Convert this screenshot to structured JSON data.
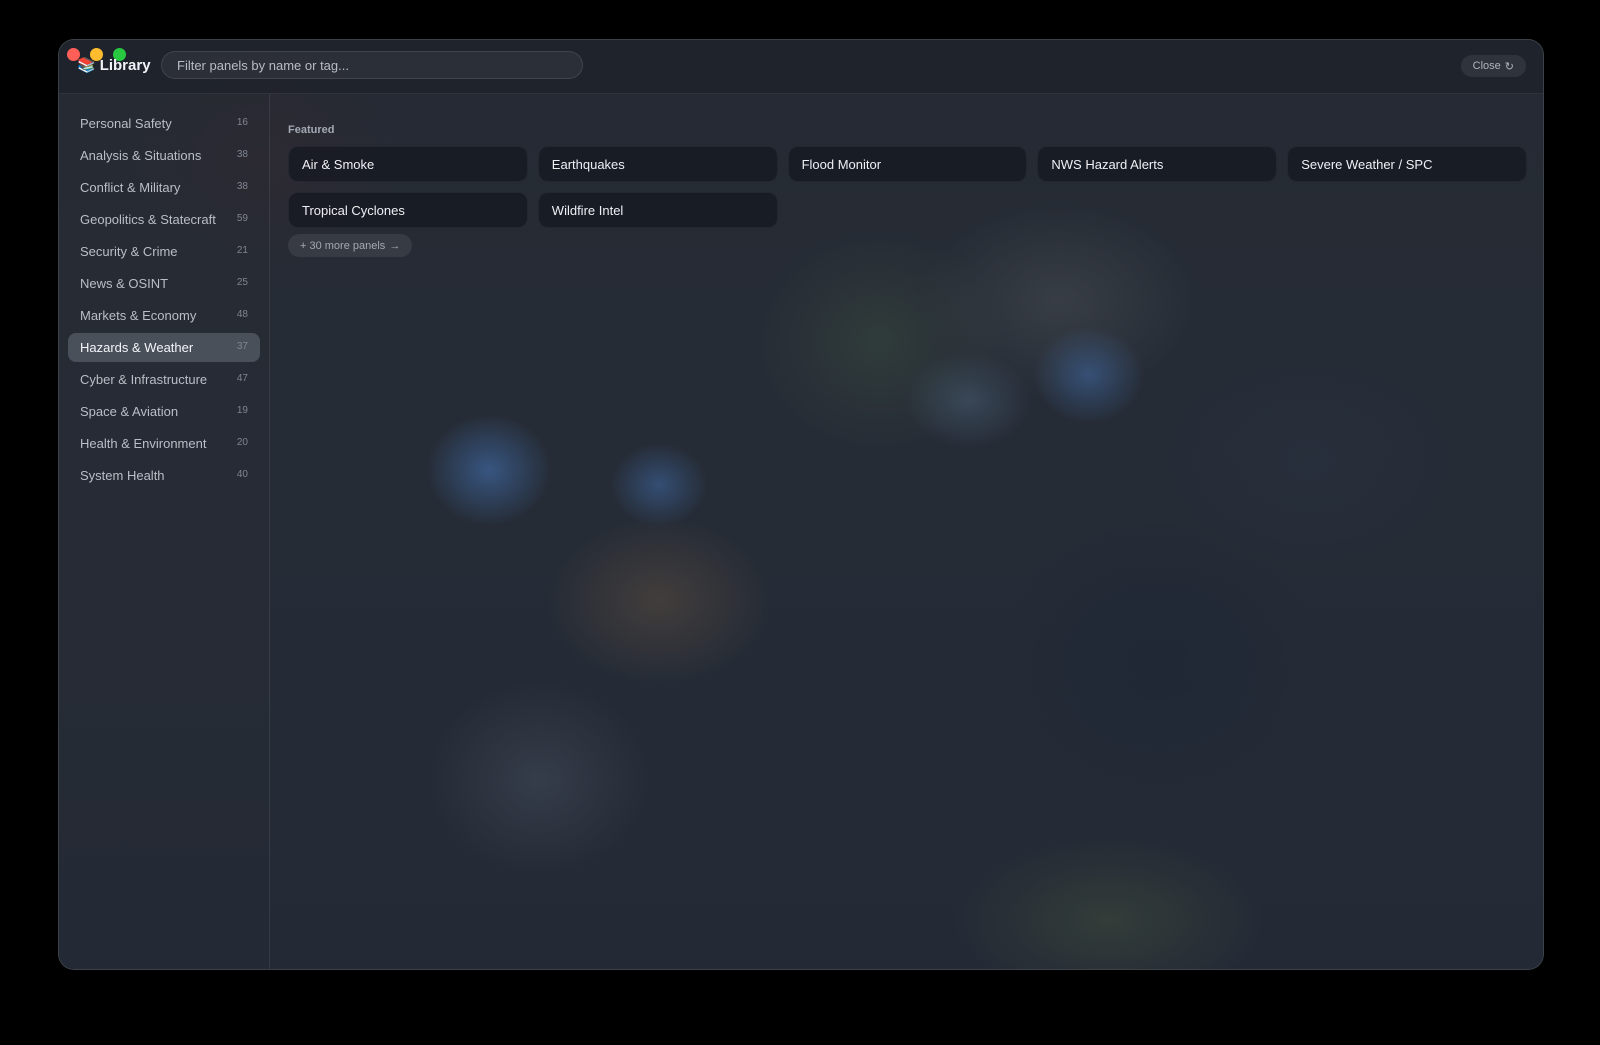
{
  "header": {
    "title": "Library",
    "brand_icon": "books-icon",
    "search_placeholder": "Filter panels by name or tag...",
    "close_label": "Close",
    "close_icon": "↻"
  },
  "sidebar": {
    "items": [
      {
        "label": "Personal Safety",
        "count": "16"
      },
      {
        "label": "Analysis & Situations",
        "count": "38"
      },
      {
        "label": "Conflict & Military",
        "count": "38"
      },
      {
        "label": "Geopolitics & Statecraft",
        "count": "59"
      },
      {
        "label": "Security & Crime",
        "count": "21"
      },
      {
        "label": "News & OSINT",
        "count": "25"
      },
      {
        "label": "Markets & Economy",
        "count": "48"
      },
      {
        "label": "Hazards & Weather",
        "count": "37"
      },
      {
        "label": "Cyber & Infrastructure",
        "count": "47"
      },
      {
        "label": "Space & Aviation",
        "count": "19"
      },
      {
        "label": "Health & Environment",
        "count": "20"
      },
      {
        "label": "System Health",
        "count": "40"
      }
    ],
    "active_index": 7
  },
  "main": {
    "section_label": "Featured",
    "panels": [
      "Air & Smoke",
      "Earthquakes",
      "Flood Monitor",
      "NWS Hazard Alerts",
      "Severe Weather / SPC",
      "Tropical Cyclones",
      "Wildfire Intel"
    ],
    "more_label": "+ 30 more panels",
    "more_icon": "→"
  },
  "colors": {
    "accent_active": "#5a606b",
    "window_bg": "#1e232c",
    "traffic_red": "#ff5f57",
    "traffic_yellow": "#febc2e",
    "traffic_green": "#28c840"
  }
}
